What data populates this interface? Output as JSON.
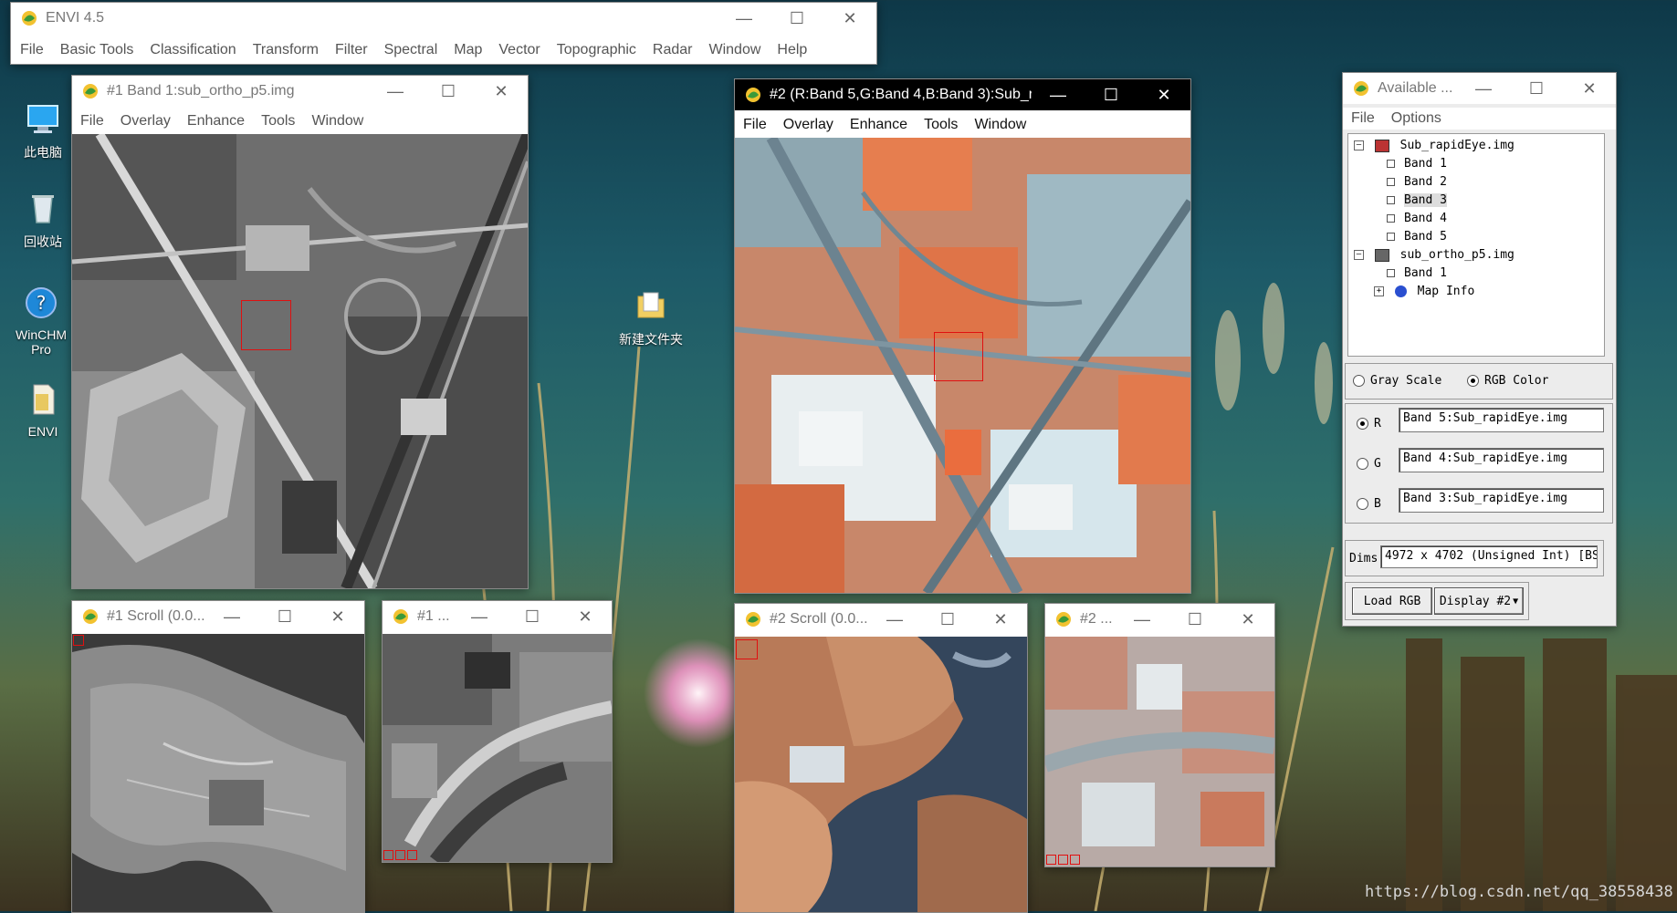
{
  "desktop": {
    "icons": [
      {
        "label": "此电脑"
      },
      {
        "label": "回收站"
      },
      {
        "label": "WinCHM Pro"
      },
      {
        "label": "ENVI"
      },
      {
        "label": "新建文件夹"
      }
    ],
    "watermark": "https://blog.csdn.net/qq_38558438"
  },
  "main_window": {
    "title": "ENVI 4.5",
    "menu": [
      "File",
      "Basic Tools",
      "Classification",
      "Transform",
      "Filter",
      "Spectral",
      "Map",
      "Vector",
      "Topographic",
      "Radar",
      "Window",
      "Help"
    ]
  },
  "display1": {
    "title": "#1 Band 1:sub_ortho_p5.img",
    "menu": [
      "File",
      "Overlay",
      "Enhance",
      "Tools",
      "Window"
    ]
  },
  "display2": {
    "title": "#2 (R:Band 5,G:Band 4,B:Band 3):Sub_r...",
    "menu": [
      "File",
      "Overlay",
      "Enhance",
      "Tools",
      "Window"
    ]
  },
  "scroll1": {
    "title": "#1 Scroll (0.0..."
  },
  "zoom1": {
    "title": "#1 ..."
  },
  "scroll2": {
    "title": "#2 Scroll (0.0..."
  },
  "zoom2": {
    "title": "#2 ..."
  },
  "available": {
    "title": "Available ...",
    "menu": [
      "File",
      "Options"
    ],
    "tree": {
      "file1": "Sub_rapidEye.img",
      "file1_bands": [
        "Band 1",
        "Band 2",
        "Band 3",
        "Band 4",
        "Band 5"
      ],
      "file2": "sub_ortho_p5.img",
      "file2_bands": [
        "Band 1"
      ],
      "map_info": "Map Info"
    },
    "mode_gray": "Gray Scale",
    "mode_rgb": "RGB Color",
    "mode_selected": "RGB Color",
    "r_label": "R",
    "g_label": "G",
    "b_label": "B",
    "r_value": "Band 5:Sub_rapidEye.img",
    "g_value": "Band 4:Sub_rapidEye.img",
    "b_value": "Band 3:Sub_rapidEye.img",
    "dims_label": "Dims",
    "dims_value": "4972 x 4702 (Unsigned Int) [BS",
    "load_button": "Load RGB",
    "display_button": "Display #2"
  },
  "colors": {
    "false_color_red": "#e06a3c",
    "false_color_cyan": "#cfe3ea",
    "roi_box": "#e01010"
  }
}
